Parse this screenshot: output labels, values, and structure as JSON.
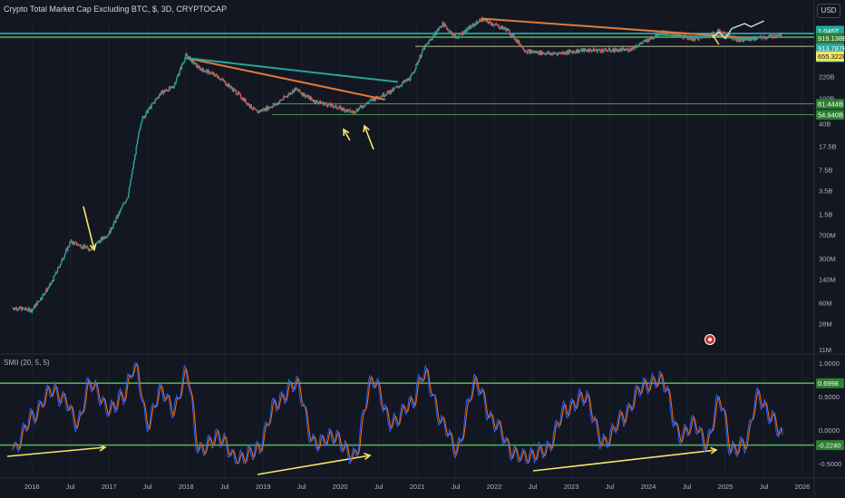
{
  "header": {
    "title": "Crypto Total Market Cap Excluding BTC, $, 3D, CRYPTOCAP",
    "currency": "USD",
    "indicator": "SMII (20, 5, 5)"
  },
  "colors": {
    "background": "#131722",
    "up_candle": "#26a69a",
    "down_candle": "#ef5350",
    "green_line": "#4caf50",
    "cyan_line": "#2bb8d4",
    "orange_line": "#e07b39",
    "yellow_annotation": "#f5e663",
    "smi_line": "#2962ff",
    "signal_line": "#ff6d00",
    "value_tag_green": "#26a69a",
    "value_tag_yellow": "#f5e663"
  },
  "chart_data": [
    {
      "type": "line",
      "panel": "price",
      "scale": "log",
      "title": "Crypto Total Market Cap Excluding BTC, $, 3D, CRYPTOCAP",
      "x_ticks": [
        "2016",
        "Jul",
        "2017",
        "Jul",
        "2018",
        "Jul",
        "2019",
        "Jul",
        "2020",
        "Jul",
        "2021",
        "Jul",
        "2022",
        "Jul",
        "2023",
        "Jul",
        "2024",
        "Jul",
        "2025",
        "Jul",
        "2026"
      ],
      "y_ticks": [
        "1.045T",
        "220B",
        "100B",
        "40B",
        "17.5B",
        "7.5B",
        "3.5B",
        "1.5B",
        "700M",
        "300M",
        "140M",
        "60M",
        "28M",
        "11M"
      ],
      "series": [
        {
          "values": [
            [
              "2015-10",
              0.05
            ],
            [
              "2016-01",
              0.046
            ],
            [
              "2016-04",
              0.12
            ],
            [
              "2016-07",
              0.55
            ],
            [
              "2016-10",
              0.42
            ],
            [
              "2017-01",
              0.75
            ],
            [
              "2017-04",
              3
            ],
            [
              "2017-06",
              45
            ],
            [
              "2017-09",
              120
            ],
            [
              "2017-11",
              150
            ],
            [
              "2018-01",
              480
            ],
            [
              "2018-03",
              300
            ],
            [
              "2018-06",
              220
            ],
            [
              "2018-09",
              120
            ],
            [
              "2018-12",
              60
            ],
            [
              "2019-03",
              80
            ],
            [
              "2019-06",
              140
            ],
            [
              "2019-09",
              90
            ],
            [
              "2019-12",
              75
            ],
            [
              "2020-03",
              60
            ],
            [
              "2020-06",
              95
            ],
            [
              "2020-09",
              130
            ],
            [
              "2020-12",
              210
            ],
            [
              "2021-02",
              600
            ],
            [
              "2021-05",
              1500
            ],
            [
              "2021-07",
              900
            ],
            [
              "2021-11",
              1750
            ],
            [
              "2022-03",
              1200
            ],
            [
              "2022-06",
              550
            ],
            [
              "2022-10",
              500
            ],
            [
              "2023-03",
              570
            ],
            [
              "2023-07",
              570
            ],
            [
              "2023-10",
              580
            ],
            [
              "2024-01",
              840
            ],
            [
              "2024-03",
              1100
            ],
            [
              "2024-06",
              950
            ],
            [
              "2024-08",
              860
            ],
            [
              "2024-10",
              940
            ],
            [
              "2024-12",
              1150
            ],
            [
              "2025-03",
              830
            ],
            [
              "2025-06",
              880
            ],
            [
              "2025-10",
              1000
            ]
          ]
        }
      ],
      "horizontal_levels": [
        {
          "value": 1045,
          "label": "1.045T",
          "color": "cyan_line"
        },
        {
          "value": 919.138,
          "label": "919.138B",
          "color": "green_line"
        },
        {
          "value": 913.787,
          "label": "913.787B",
          "color": "green_line"
        },
        {
          "value": 655.322,
          "label": "655.322B",
          "color": "yellow"
        },
        {
          "value": 81.444,
          "label": "81.444B",
          "color": "green_line"
        },
        {
          "value": 54.94,
          "label": "54.940B",
          "color": "green_line"
        }
      ],
      "countdown_tag": "1d 16h"
    },
    {
      "type": "line",
      "panel": "indicator",
      "title": "SMII (20, 5, 5)",
      "ylim": [
        -0.5,
        1.0
      ],
      "y_ticks": [
        "1.0000",
        "0.5000",
        "0.0000",
        "-0.5000"
      ],
      "series": [
        {
          "values": [
            [
              "2015-10",
              -0.3
            ],
            [
              "2016-01",
              0.2
            ],
            [
              "2016-04",
              0.6
            ],
            [
              "2016-06",
              0.45
            ],
            [
              "2016-08",
              0.1
            ],
            [
              "2016-10",
              0.7
            ],
            [
              "2017-01",
              0.3
            ],
            [
              "2017-03",
              0.5
            ],
            [
              "2017-05",
              0.95
            ],
            [
              "2017-07",
              0.1
            ],
            [
              "2017-09",
              0.6
            ],
            [
              "2017-11",
              0.3
            ],
            [
              "2018-01",
              0.85
            ],
            [
              "2018-03",
              -0.3
            ],
            [
              "2018-06",
              -0.1
            ],
            [
              "2018-09",
              -0.45
            ],
            [
              "2018-12",
              -0.3
            ],
            [
              "2019-03",
              0.4
            ],
            [
              "2019-06",
              0.7
            ],
            [
              "2019-09",
              -0.2
            ],
            [
              "2019-12",
              -0.1
            ],
            [
              "2020-03",
              -0.4
            ],
            [
              "2020-06",
              0.75
            ],
            [
              "2020-09",
              0.1
            ],
            [
              "2020-12",
              0.4
            ],
            [
              "2021-02",
              0.85
            ],
            [
              "2021-05",
              0.1
            ],
            [
              "2021-07",
              -0.3
            ],
            [
              "2021-10",
              0.7
            ],
            [
              "2022-01",
              0.1
            ],
            [
              "2022-04",
              -0.35
            ],
            [
              "2022-06",
              -0.4
            ],
            [
              "2022-09",
              -0.3
            ],
            [
              "2022-12",
              0.3
            ],
            [
              "2023-03",
              0.5
            ],
            [
              "2023-06",
              -0.2
            ],
            [
              "2023-09",
              0.2
            ],
            [
              "2023-12",
              0.65
            ],
            [
              "2024-03",
              0.75
            ],
            [
              "2024-06",
              -0.1
            ],
            [
              "2024-08",
              0.1
            ],
            [
              "2024-10",
              -0.2
            ],
            [
              "2024-12",
              0.45
            ],
            [
              "2025-02",
              -0.3
            ],
            [
              "2025-04",
              -0.2
            ],
            [
              "2025-06",
              0.5
            ],
            [
              "2025-08",
              0.2
            ],
            [
              "2025-10",
              -0.1
            ]
          ]
        }
      ],
      "horizontal_levels": [
        {
          "value": 0.6998,
          "label": "0.6998"
        },
        {
          "value": -0.224,
          "label": "-0.2240"
        }
      ]
    }
  ]
}
